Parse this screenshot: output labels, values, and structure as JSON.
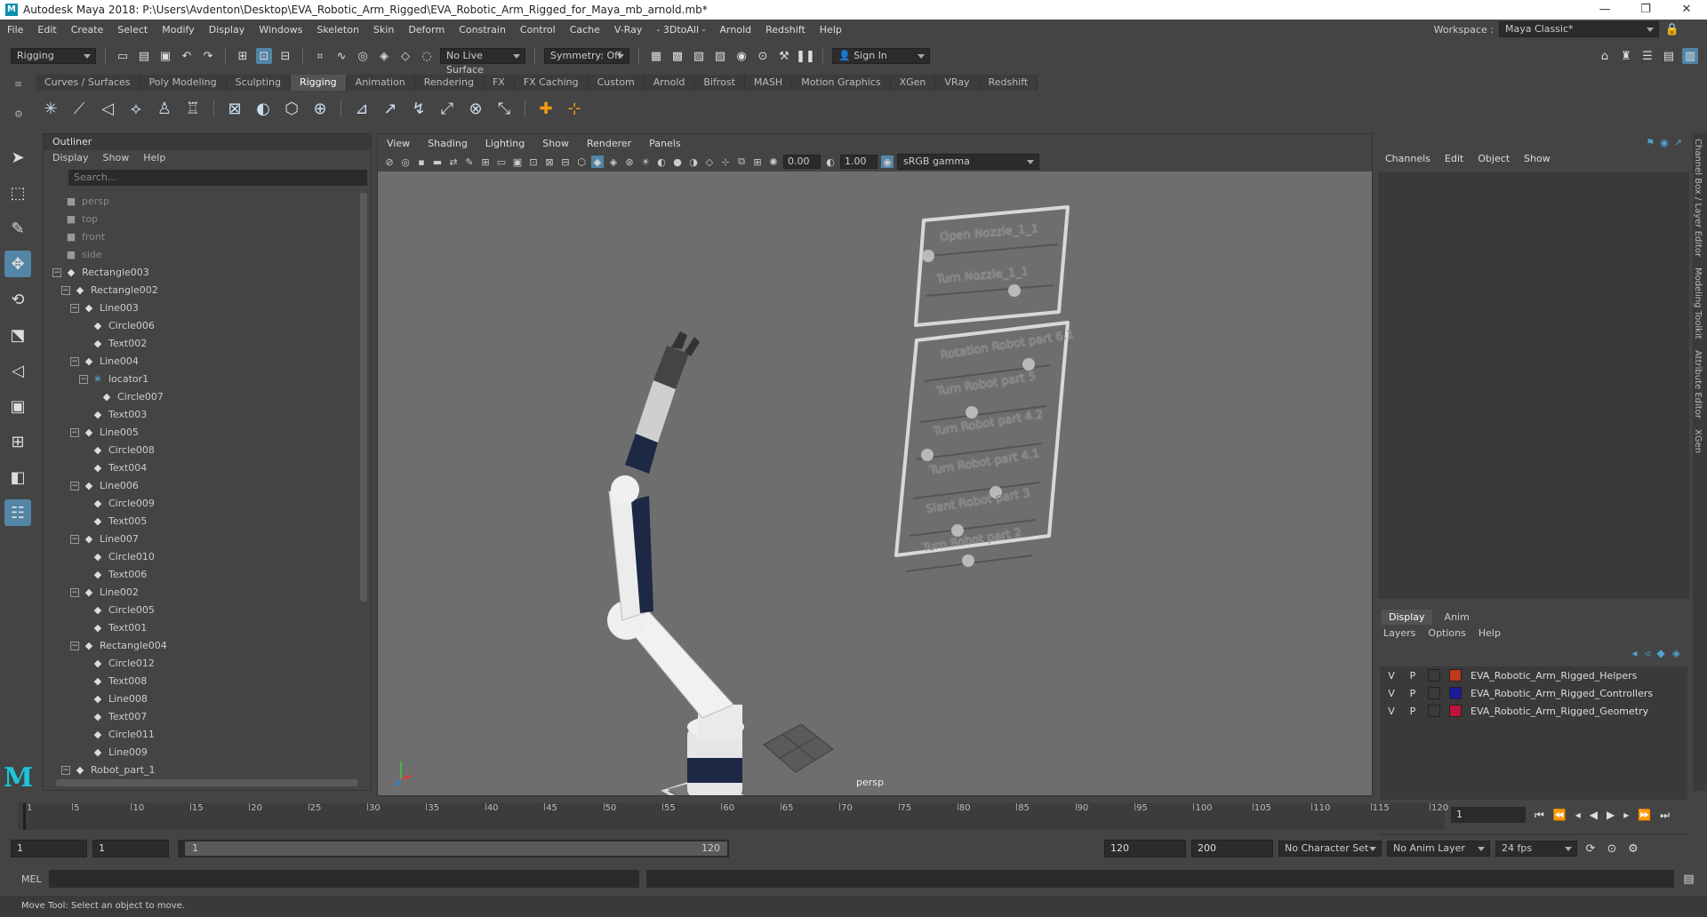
{
  "window": {
    "title": "Autodesk Maya 2018: P:\\Users\\Avdenton\\Desktop\\EVA_Robotic_Arm_Rigged\\EVA_Robotic_Arm_Rigged_for_Maya_mb_arnold.mb*",
    "minimize": "—",
    "maximize": "❐",
    "close": "✕"
  },
  "menu": [
    "File",
    "Edit",
    "Create",
    "Select",
    "Modify",
    "Display",
    "Windows",
    "Skeleton",
    "Skin",
    "Deform",
    "Constrain",
    "Control",
    "Cache",
    "V-Ray",
    "- 3DtoAll -",
    "Arnold",
    "Redshift",
    "Help"
  ],
  "workspace": {
    "label": "Workspace :",
    "value": "Maya Classic*"
  },
  "statusline": {
    "mode": "Rigging",
    "live_surface": "No Live Surface",
    "symmetry": "Symmetry: Off",
    "sign_in": "Sign In"
  },
  "shelf_tabs": [
    "Curves / Surfaces",
    "Poly Modeling",
    "Sculpting",
    "Rigging",
    "Animation",
    "Rendering",
    "FX",
    "FX Caching",
    "Custom",
    "Arnold",
    "Bifrost",
    "MASH",
    "Motion Graphics",
    "XGen",
    "VRay",
    "Redshift"
  ],
  "shelf_active": "Rigging",
  "outliner": {
    "title": "Outliner",
    "menu": [
      "Display",
      "Show",
      "Help"
    ],
    "search_placeholder": "Search...",
    "nodes": [
      {
        "label": "persp",
        "depth": 0,
        "icon": "camera",
        "dim": true
      },
      {
        "label": "top",
        "depth": 0,
        "icon": "camera",
        "dim": true
      },
      {
        "label": "front",
        "depth": 0,
        "icon": "camera",
        "dim": true
      },
      {
        "label": "side",
        "depth": 0,
        "icon": "camera",
        "dim": true
      },
      {
        "label": "Rectangle003",
        "depth": 0,
        "icon": "transform",
        "exp": true
      },
      {
        "label": "Rectangle002",
        "depth": 1,
        "icon": "transform",
        "exp": true
      },
      {
        "label": "Line003",
        "depth": 2,
        "icon": "transform",
        "exp": true
      },
      {
        "label": "Circle006",
        "depth": 3,
        "icon": "transform"
      },
      {
        "label": "Text002",
        "depth": 3,
        "icon": "transform"
      },
      {
        "label": "Line004",
        "depth": 2,
        "icon": "transform",
        "exp": true
      },
      {
        "label": "locator1",
        "depth": 3,
        "icon": "locator",
        "exp": true
      },
      {
        "label": "Circle007",
        "depth": 4,
        "icon": "transform"
      },
      {
        "label": "Text003",
        "depth": 3,
        "icon": "transform"
      },
      {
        "label": "Line005",
        "depth": 2,
        "icon": "transform",
        "exp": true
      },
      {
        "label": "Circle008",
        "depth": 3,
        "icon": "transform"
      },
      {
        "label": "Text004",
        "depth": 3,
        "icon": "transform"
      },
      {
        "label": "Line006",
        "depth": 2,
        "icon": "transform",
        "exp": true
      },
      {
        "label": "Circle009",
        "depth": 3,
        "icon": "transform"
      },
      {
        "label": "Text005",
        "depth": 3,
        "icon": "transform"
      },
      {
        "label": "Line007",
        "depth": 2,
        "icon": "transform",
        "exp": true
      },
      {
        "label": "Circle010",
        "depth": 3,
        "icon": "transform"
      },
      {
        "label": "Text006",
        "depth": 3,
        "icon": "transform"
      },
      {
        "label": "Line002",
        "depth": 2,
        "icon": "transform",
        "exp": true
      },
      {
        "label": "Circle005",
        "depth": 3,
        "icon": "transform"
      },
      {
        "label": "Text001",
        "depth": 3,
        "icon": "transform"
      },
      {
        "label": "Rectangle004",
        "depth": 2,
        "icon": "transform",
        "exp": true
      },
      {
        "label": "Circle012",
        "depth": 3,
        "icon": "transform"
      },
      {
        "label": "Text008",
        "depth": 3,
        "icon": "transform"
      },
      {
        "label": "Line008",
        "depth": 3,
        "icon": "transform"
      },
      {
        "label": "Text007",
        "depth": 3,
        "icon": "transform"
      },
      {
        "label": "Circle011",
        "depth": 3,
        "icon": "transform"
      },
      {
        "label": "Line009",
        "depth": 3,
        "icon": "transform"
      },
      {
        "label": "Robot_part_1",
        "depth": 1,
        "icon": "transform",
        "exp": true
      }
    ]
  },
  "viewport": {
    "menu": [
      "View",
      "Shading",
      "Lighting",
      "Show",
      "Renderer",
      "Panels"
    ],
    "value1": "0.00",
    "value2": "1.00",
    "colorspace": "sRGB gamma",
    "camera": "persp",
    "panel_labels_top": [
      "Open Nozzle_1_1",
      "Turn Nozzle_1_1"
    ],
    "panel_labels_bottom": [
      "Rotation Robot part 6.1",
      "Turn Robot part 5",
      "Turn Robot part 4.2",
      "Turn Robot part 4.1",
      "Slant Robot part 3",
      "Turn Robot part 2"
    ]
  },
  "channelbox": {
    "menu": [
      "Channels",
      "Edit",
      "Object",
      "Show"
    ],
    "tabs": [
      "Display",
      "Anim"
    ],
    "layer_menu": [
      "Layers",
      "Options",
      "Help"
    ],
    "layers": [
      {
        "v": "V",
        "p": "P",
        "name": "EVA_Robotic_Arm_Rigged_Helpers",
        "color": "#c0391b"
      },
      {
        "v": "V",
        "p": "P",
        "name": "EVA_Robotic_Arm_Rigged_Controllers",
        "color": "#1c1c9a"
      },
      {
        "v": "V",
        "p": "P",
        "name": "EVA_Robotic_Arm_Rigged_Geometry",
        "color": "#c0143c"
      }
    ]
  },
  "side_tabs": [
    "Channel Box / Layer Editor",
    "Modeling Toolkit",
    "Attribute Editor",
    "XGen"
  ],
  "timeline": {
    "ticks": [
      1,
      5,
      10,
      15,
      20,
      25,
      30,
      35,
      40,
      45,
      50,
      55,
      60,
      65,
      70,
      75,
      80,
      85,
      90,
      95,
      100,
      105,
      110,
      115,
      120
    ],
    "current_frame": "1"
  },
  "range": {
    "start": "1",
    "start2": "1",
    "inner_start": "1",
    "inner_end": "120",
    "end": "120",
    "end2": "200",
    "char_set": "No Character Set",
    "anim_layer": "No Anim Layer",
    "fps": "24 fps"
  },
  "mel": {
    "label": "MEL"
  },
  "helpline": "Move Tool: Select an object to move."
}
